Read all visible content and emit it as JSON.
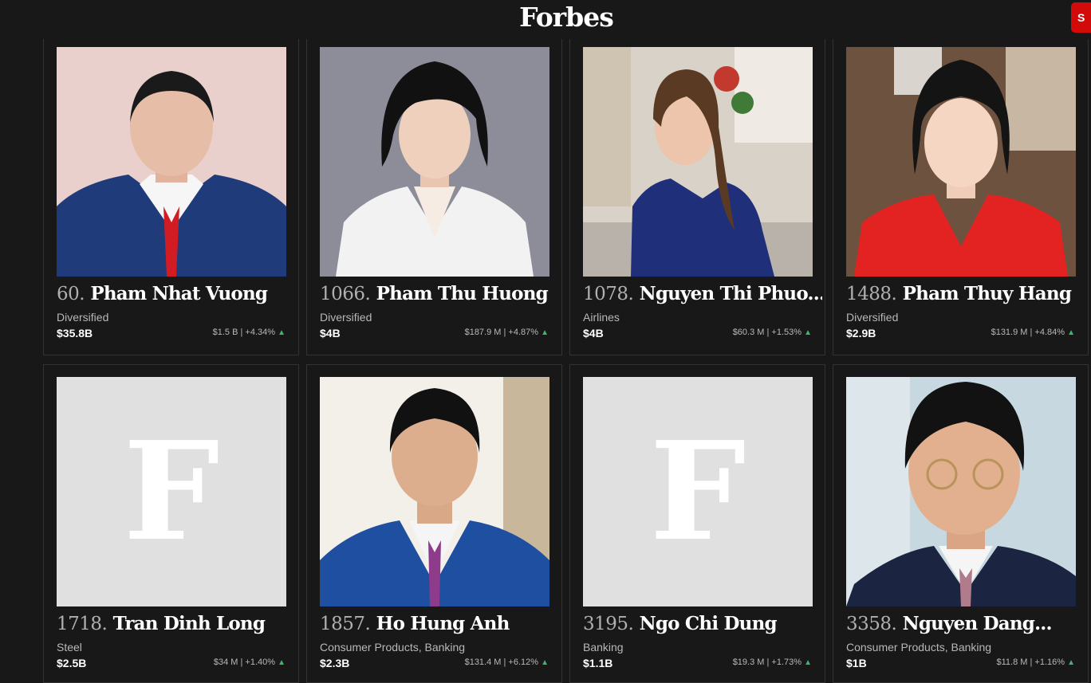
{
  "header": {
    "logo": "Forbes",
    "subscribe_label": "S"
  },
  "cards": [
    {
      "rank": "60.",
      "name": "Pham Nhat Vuong",
      "industry": "Diversified",
      "net_worth": "$35.8B",
      "change": "$1.5 B | +4.34%",
      "trend_icon": "▲",
      "photo": "portrait"
    },
    {
      "rank": "1066.",
      "name": "Pham Thu Huong",
      "industry": "Diversified",
      "net_worth": "$4B",
      "change": "$187.9 M | +4.87%",
      "trend_icon": "▲",
      "photo": "portrait"
    },
    {
      "rank": "1078.",
      "name": "Nguyen Thi Phuo...",
      "industry": "Airlines",
      "net_worth": "$4B",
      "change": "$60.3 M | +1.53%",
      "trend_icon": "▲",
      "photo": "portrait"
    },
    {
      "rank": "1488.",
      "name": "Pham Thuy Hang",
      "industry": "Diversified",
      "net_worth": "$2.9B",
      "change": "$131.9 M | +4.84%",
      "trend_icon": "▲",
      "photo": "portrait"
    },
    {
      "rank": "1718.",
      "name": "Tran Dinh Long",
      "industry": "Steel",
      "net_worth": "$2.5B",
      "change": "$34 M | +1.40%",
      "trend_icon": "▲",
      "photo": "placeholder",
      "placeholder_letter": "F"
    },
    {
      "rank": "1857.",
      "name": "Ho Hung Anh",
      "industry": "Consumer Products, Banking",
      "net_worth": "$2.3B",
      "change": "$131.4 M | +6.12%",
      "trend_icon": "▲",
      "photo": "portrait"
    },
    {
      "rank": "3195.",
      "name": "Ngo Chi Dung",
      "industry": "Banking",
      "net_worth": "$1.1B",
      "change": "$19.3 M | +1.73%",
      "trend_icon": "▲",
      "photo": "placeholder",
      "placeholder_letter": "F"
    },
    {
      "rank": "3358.",
      "name": "Nguyen Dang...",
      "industry": "Consumer Products, Banking",
      "net_worth": "$1B",
      "change": "$11.8 M | +1.16%",
      "trend_icon": "▲",
      "photo": "portrait"
    }
  ],
  "colors": {
    "background": "#181818",
    "brand_red": "#d20a0a",
    "positive": "#3ab86b"
  }
}
